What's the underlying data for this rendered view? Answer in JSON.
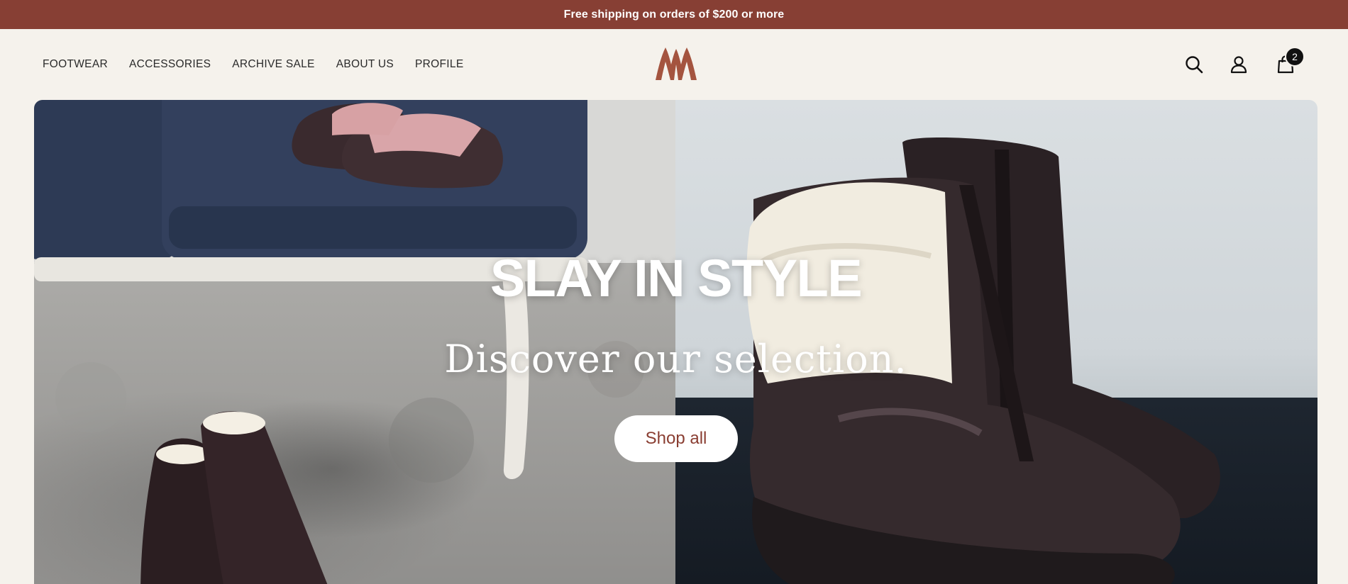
{
  "announcement": {
    "text": "Free shipping on orders of $200 or more"
  },
  "nav": {
    "items": [
      {
        "label": "FOOTWEAR"
      },
      {
        "label": "ACCESSORIES"
      },
      {
        "label": "ARCHIVE SALE"
      },
      {
        "label": "ABOUT US"
      },
      {
        "label": "PROFILE"
      }
    ]
  },
  "header": {
    "logo_icon": "brand-logo-icon",
    "icons": [
      "search-icon",
      "account-icon",
      "cart-bag-icon"
    ],
    "cart_count": "2"
  },
  "hero": {
    "title": "SLAY IN STYLE",
    "subtitle": "Discover our selection.",
    "cta_label": "Shop all"
  },
  "colors": {
    "brand": "#873f34",
    "background": "#f5f2ec",
    "cta_text": "#8a3e32"
  }
}
